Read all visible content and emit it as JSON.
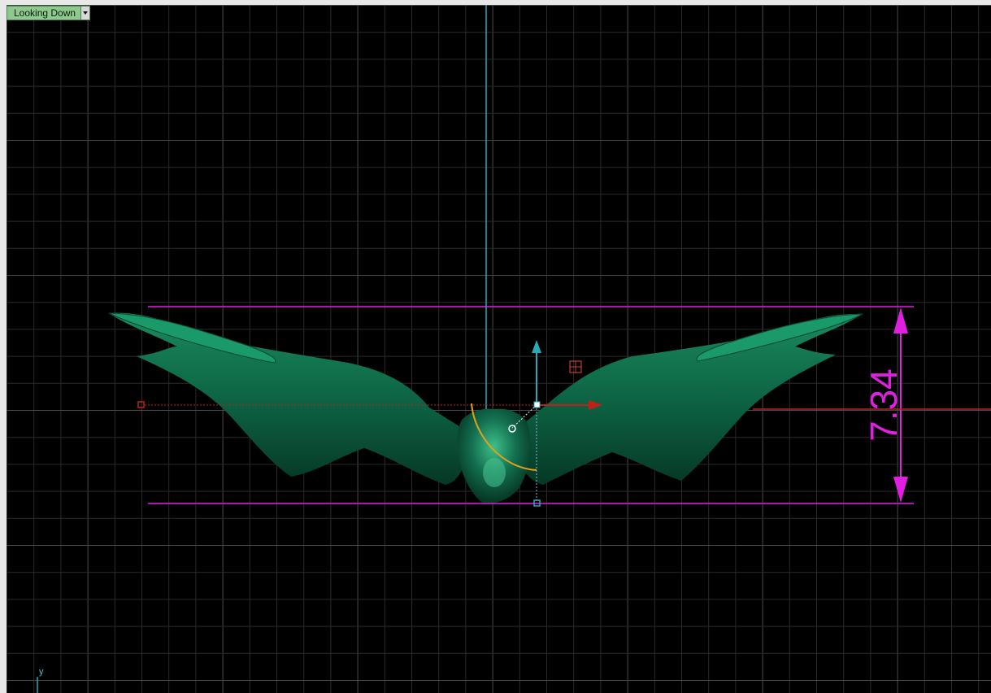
{
  "viewport": {
    "view_label": "Looking Down",
    "dimension_value": "7.34",
    "axis_label_y": "y"
  },
  "colors": {
    "background": "#000000",
    "grid_minor": "#2a2a2a",
    "grid_major": "#4a4a4a",
    "model": "#0f6b4a",
    "dimension": "#e020e0",
    "axis_cyan": "#2aa7b8",
    "axis_red": "#c0201a",
    "rotate_arc": "#e0a21a"
  },
  "icons": [
    "chevron-down-icon",
    "move-gizmo-icon",
    "rotate-arc-icon",
    "scale-handle-icon",
    "axis-y-icon"
  ]
}
